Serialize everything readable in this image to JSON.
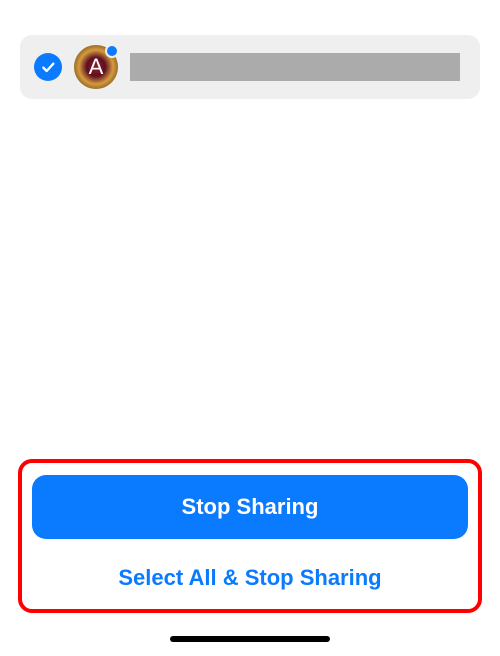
{
  "contact": {
    "selected": true,
    "avatar_letter": "A",
    "has_blue_dot": true
  },
  "buttons": {
    "stop_sharing": "Stop Sharing",
    "select_all_stop": "Select All & Stop Sharing"
  },
  "colors": {
    "accent": "#0a7aff",
    "highlight_border": "#ff0000"
  }
}
